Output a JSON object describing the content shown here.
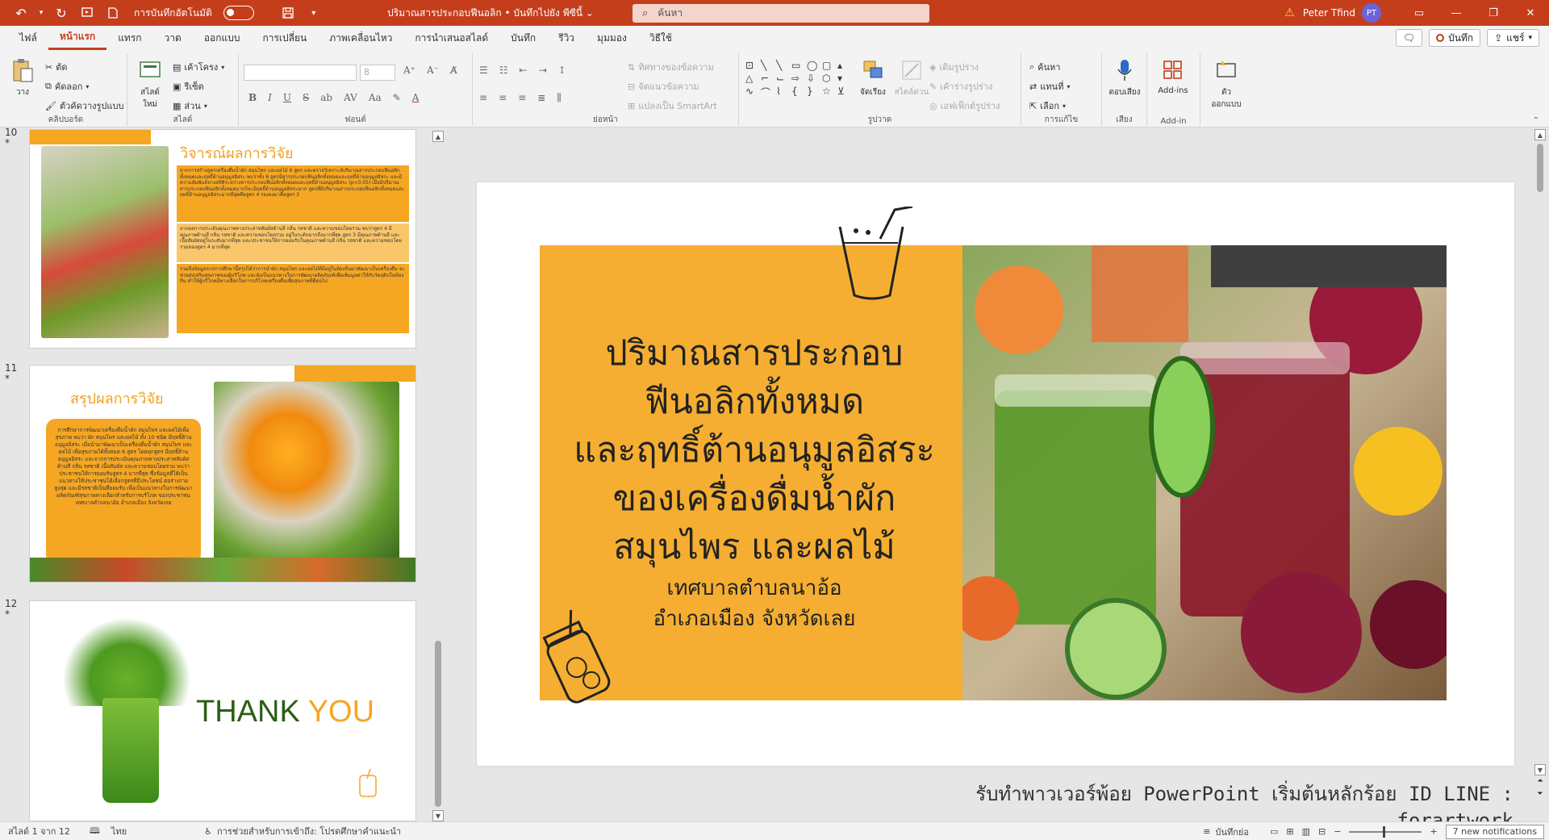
{
  "titlebar": {
    "autosave_label": "การบันทึกอัตโนมัติ",
    "doc_title": "ปริมาณสารประกอบฟีนอลิก • บันทึกไปยัง พีซีนี้",
    "search_placeholder": "ค้นหา",
    "user_name": "Peter Tfind",
    "avatar_initials": "PT",
    "accent_color": "#c43e1c"
  },
  "ribbon_tabs": [
    "ไฟล์",
    "หน้าแรก",
    "แทรก",
    "วาด",
    "ออกแบบ",
    "การเปลี่ยน",
    "ภาพเคลื่อนไหว",
    "การนำเสนอสไลด์",
    "บันทึก",
    "รีวิว",
    "มุมมอง",
    "วิธีใช้"
  ],
  "ribbon_buttons": {
    "record": "บันทึก",
    "share": "แชร์"
  },
  "ribbon": {
    "clipboard": {
      "paste": "วาง",
      "cut": "ตัด",
      "copy": "คัดลอก",
      "format_painter": "ตัวคัดวางรูปแบบ",
      "label": "คลิปบอร์ด"
    },
    "slides": {
      "new_slide": "สไลด์ใหม่",
      "layout": "เค้าโครง",
      "reset": "รีเซ็ต",
      "section": "ส่วน",
      "label": "สไลด์"
    },
    "font": {
      "size": "8",
      "label": "ฟอนต์"
    },
    "paragraph": {
      "text_direction": "ทิศทางของข้อความ",
      "align_text": "จัดแนวข้อความ",
      "smartart": "แปลงเป็น SmartArt",
      "label": "ย่อหน้า"
    },
    "drawing": {
      "arrange": "จัดเรียง",
      "quick_styles": "สไตล์ด่วน",
      "shape_fill": "เติมรูปร่าง",
      "shape_outline": "เค้าร่างรูปร่าง",
      "shape_effects": "เอฟเฟ็กต์รูปร่าง",
      "label": "รูปวาด"
    },
    "editing": {
      "find": "ค้นหา",
      "replace": "แทนที่",
      "select": "เลือก",
      "label": "การแก้ไข"
    },
    "voice": {
      "dictate": "ตอบเสียง",
      "label": "เสียง"
    },
    "addins": {
      "addins": "Add-ins",
      "label": "Add-in"
    },
    "designer": {
      "label": "ตัวออกแบบ"
    }
  },
  "thumbnails": [
    {
      "number": "10",
      "title": "วิจารณ์ผลการวิจัย",
      "paragraphs": [
        "จากการสร้างสูตรเครื่องดื่มน้ำผัก สมุนไพร และผลไม้ 6 สูตร และตรวจวิเคราะห์ปริมาณสารประกอบฟีนอลิกทั้งหมดและฤทธิ์ต้านอนุมูลอิสระ พบว่าทั้ง 6 สูตรมีสารประกอบฟีนอลิกทั้งหมดและฤทธิ์ต้านอนุมูลอิสระ และมีความสัมพันธ์ทางสถิติระหว่างสารประกอบฟีนอลิกทั้งหมดและฤทธิ์ต้านอนุมูลอิสระ (p<0.05) เมื่อมีปริมาณสารประกอบฟีนอลิกทั้งหมดมากก็จะมีฤทธิ์ต้านอนุมูลอิสระมาก สูตรที่มีปริมาณสารประกอบฟีนอลิกทั้งหมดและฤทธิ์ต้านอนุมูลอิสระมากที่สุดคือสูตร 4 รองลงมาคือสูตร 3",
        "จากผลการประเมินคุณภาพทางประสาทสัมผัสด้านสี กลิ่น รสชาติ และความชอบโดยรวม พบว่าสูตร 4 มีคุณภาพด้านสี กลิ่น รสชาติ และความชอบโดยรวม อยู่ในระดับมากถึงมากที่สุด สูตร 3 มีคุณภาพด้านสี และเนื้อสัมผัสอยู่ในระดับมากที่สุด และประชาชนให้การยอมรับในคุณภาพด้านสี กลิ่น รสชาติ และความชอบโดยรวมของสูตร 4 มากที่สุด",
        "รวมถึงข้อมูลจากการศึกษานี้สรุปได้ว่าการนำผัก สมุนไพร และผลไม้ที่มีอยู่ในท้องถิ่นมาพัฒนาเป็นเครื่องดื่ม จะช่วยส่งเสริมสุขภาพของผู้บริโภค และยังเป็นแนวทางในการพัฒนาผลิตภัณฑ์เพื่อเพิ่มมูลค่าให้กับวัตถุดิบในท้องถิ่น ทำให้ผู้บริโภคมีทางเลือกในการบริโภคเครื่องดื่มเพื่อสุขภาพที่ดีต่อไป"
      ]
    },
    {
      "number": "11",
      "title": "สรุปผลการวิจัย",
      "body": "การศึกษาการพัฒนาเครื่องดื่มน้ำผัก สมุนไพร และผลไม้เพื่อสุขภาพ พบว่า ผัก สมุนไพร และผลไม้ ทั้ง 10 ชนิด มีฤทธิ์ต้านอนุมูลอิสระ เมื่อนำมาพัฒนาเป็นเครื่องดื่มน้ำผัก สมุนไพร และผลไม้ เพื่อสุขภาพได้ทั้งหมด 6 สูตร โดยทุกสูตร มีฤทธิ์ต้านอนุมูลอิสระ และจากการประเมินคุณภาพทางประสาทสัมผัส ด้านสี กลิ่น รสชาติ เนื้อสัมผัส และความชอบโดยรวม พบว่าประชาชนให้การยอมรับสูตร 4 มากที่สุด ซึ่งข้อมูลที่ได้เป็นแนวทางให้ประชาชนได้เลือกสูตรที่มีประโยชน์ ต่อร่างกายสูงสุด และมีรสชาติเป็นที่ยอมรับ เพื่อเป็นแนวทางในการพัฒนาผลิตภัณฑ์สุขภาพทางเลือกสำหรับการบริโภค ของประชาชนเทศบาลตำบลนาอ้อ อำเภอเมือง จังหวัดเลย"
    },
    {
      "number": "12",
      "thank": "THANK",
      "you": "YOU"
    }
  ],
  "slide": {
    "title_lines": [
      "ปริมาณสารประกอบ",
      "ฟีนอลิกทั้งหมด",
      "และฤทธิ์ต้านอนุมูลอิสระ",
      "ของเครื่องดื่มน้ำผัก",
      "สมุนไพร และผลไม้"
    ],
    "subtitle_lines": [
      "เทศบาลตำบลนาอ้อ",
      "อำเภอเมือง จังหวัดเลย"
    ],
    "orange": "#f5ae31"
  },
  "footer_watermark": "รับทำพาวเวอร์พ้อย PowerPoint เริ่มต้นหลักร้อย ID LINE : forartwork",
  "statusbar": {
    "slide_of": "สไลด์ 1 จาก 12",
    "language": "ไทย",
    "accessibility": "การช่วยสำหรับการเข้าถึง: โปรดศึกษาคำแนะนำ",
    "notes": "บันทึกย่อ",
    "notifications": "7 new notifications"
  }
}
